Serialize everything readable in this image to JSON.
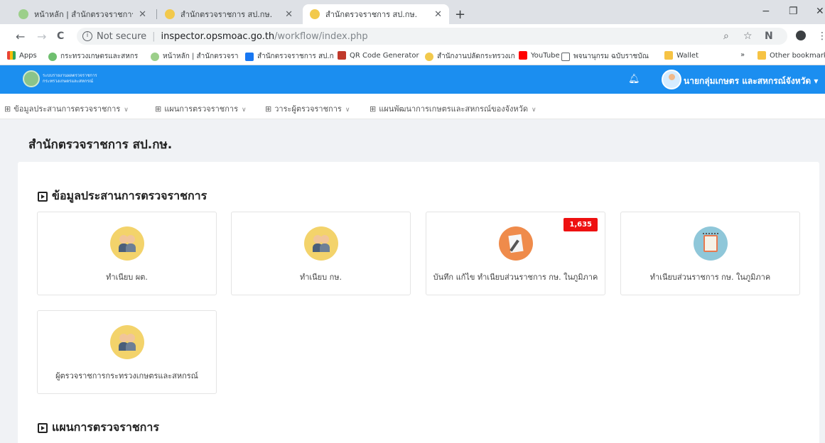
{
  "browser": {
    "tabs": [
      {
        "title": "หน้าหลัก | สำนักตรวจราชการ :",
        "close": "✕"
      },
      {
        "title": "สำนักตรวจราชการ สป.กษ.",
        "close": "✕"
      },
      {
        "title": "สำนักตรวจราชการ สป.กษ.",
        "close": "✕"
      }
    ],
    "new_tab": "+",
    "window_controls": {
      "minimize": "−",
      "maximize": "❐",
      "close": "✕"
    },
    "nav": {
      "back": "←",
      "forward": "→",
      "reload": "C"
    },
    "address": {
      "security_label": "Not secure",
      "host": "inspector.opsmoac.go.th",
      "path": "/workflow/index.php"
    },
    "bookmarks": [
      {
        "label": "Apps"
      },
      {
        "label": "กระทรวงเกษตรและสหกร"
      },
      {
        "label": "หน้าหลัก | สำนักตรวจรา"
      },
      {
        "label": "สำนักตรวจราชการ สป.ก"
      },
      {
        "label": "QR Code Generator"
      },
      {
        "label": "สำนักงานปลัดกระทรวงเก"
      },
      {
        "label": "YouTube"
      },
      {
        "label": "พจนานุกรม ฉบับราชบัณ"
      },
      {
        "label": "Wallet"
      },
      {
        "label": "»"
      },
      {
        "label": "Other bookmark"
      }
    ]
  },
  "app": {
    "brand_line1": "ระบบรายงานผลตรวจราชการ",
    "brand_line2": "กระทรวงเกษตรและสหกรณ์",
    "user_name": "นายกลุ่มเกษตร และสหกรณ์จังหวัด ▾",
    "menu": [
      {
        "label": "ข้อมูลประสานการตรวจราชการ"
      },
      {
        "label": "แผนการตรวจราชการ"
      },
      {
        "label": "วาระผู้ตรวจราชการ"
      },
      {
        "label": "แผนพัฒนาการเกษตรและสหกรณ์ของจังหวัด"
      }
    ]
  },
  "page": {
    "title": "สำนักตรวจราชการ สป.กษ.",
    "sections": [
      {
        "title": "ข้อมูลประสานการตรวจราชการ",
        "cards": [
          {
            "label": "ทำเนียบ ผต.",
            "icon": "people-icon"
          },
          {
            "label": "ทำเนียบ กษ.",
            "icon": "people-icon"
          },
          {
            "label": "บันทึก แก้ไข ทำเนียบส่วนราชการ กษ. ในภูมิภาค",
            "icon": "edit-document-icon",
            "badge": "1,635"
          },
          {
            "label": "ทำเนียบส่วนราชการ กษ. ในภูมิภาค",
            "icon": "directory-book-icon"
          },
          {
            "label": "ผู้ตรวจราชการกระทรวงเกษตรและสหกรณ์",
            "icon": "people-icon"
          }
        ]
      },
      {
        "title": "แผนการตรวจราชการ"
      }
    ]
  },
  "colors": {
    "header": "#1b8ef0",
    "badge": "#ee1111",
    "content_bg": "#f0f2f5"
  }
}
